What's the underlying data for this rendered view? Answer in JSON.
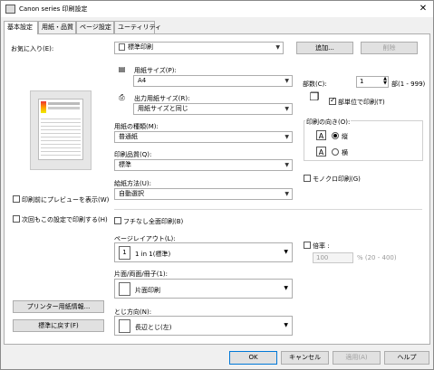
{
  "window": {
    "title": "Canon series 印刷設定"
  },
  "tabs": [
    {
      "label": "基本設定"
    },
    {
      "label": "用紙・品質"
    },
    {
      "label": "ページ設定"
    },
    {
      "label": "ユーティリティ"
    }
  ],
  "favorites": {
    "label": "お気に入り(E):",
    "value": "標準印刷",
    "add": "追加...",
    "delete": "削除"
  },
  "preview": {
    "show_label": "印刷前にプレビューを表示(W)",
    "next_label": "次回もこの設定で印刷する(H)"
  },
  "paper": {
    "size_label": "用紙サイズ(P):",
    "size_value": "A4",
    "output_label": "出力用紙サイズ(R):",
    "output_value": "用紙サイズと同じ",
    "type_label": "用紙の種類(M):",
    "type_value": "普通紙",
    "quality_label": "印刷品質(Q):",
    "quality_value": "標準",
    "feed_label": "給紙方法(U):",
    "feed_value": "自動選択"
  },
  "copies": {
    "label": "部数(C):",
    "value": "1",
    "range": "部(1 - 999)",
    "collate": "部単位で印刷(T)"
  },
  "orientation": {
    "label": "印刷の向き(O):",
    "portrait": "縦",
    "landscape": "横"
  },
  "mono": "モノクロ印刷(G)",
  "borderless": "フチなし全面印刷(B)",
  "layout": {
    "label": "ページレイアウト(L):",
    "value": "1 in 1(標準)"
  },
  "scale": {
    "label": "倍率 :",
    "value": "100",
    "range": "% (20 - 400)"
  },
  "duplex": {
    "label": "片面/両面/冊子(1):",
    "value": "片面印刷"
  },
  "binding": {
    "label": "とじ方向(N):",
    "value": "長辺とじ(左)"
  },
  "buttons": {
    "printer_paper": "プリンター用紙情報...",
    "defaults": "標準に戻す(F)",
    "ok": "OK",
    "cancel": "キャンセル",
    "apply": "適用(A)",
    "help": "ヘルプ"
  }
}
